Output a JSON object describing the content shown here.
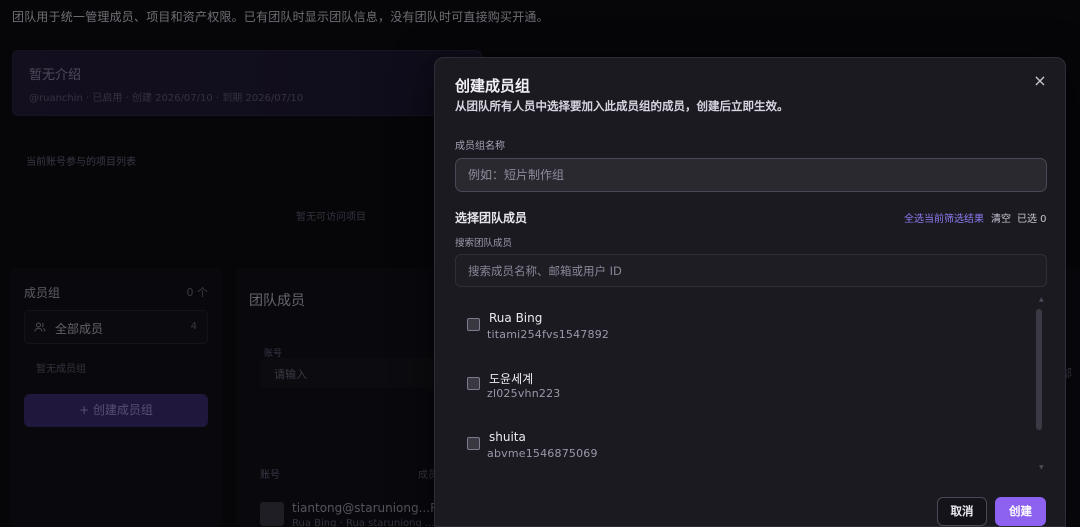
{
  "intro": "团队用于统一管理成员、项目和资产权限。已有团队时显示团队信息，没有团队时可直接购买开通。",
  "team_card": {
    "title": "暂无介绍",
    "meta": "@ruanchin  · 已启用 · 创建 2026/07/10 · 到期 2026/07/10"
  },
  "projects": {
    "label": "当前账号参与的项目列表",
    "empty": "暂无可访问项目"
  },
  "groups_panel": {
    "title": "成员组",
    "count": "0 个",
    "all_members_label": "全部成员",
    "all_members_count": "4",
    "empty": "暂无成员组",
    "create_label": "+  创建成员组"
  },
  "members_panel": {
    "title": "团队成员",
    "field_label": "账号",
    "field_placeholder": "请输入",
    "col_account": "账号",
    "col_b": "成员",
    "row_name": "tiantong@staruniong...Rua",
    "row_sub": "Rua Bing · Rua staruniong ...",
    "right_char": "部"
  },
  "modal": {
    "title": "创建成员组",
    "subtitle": "从团队所有人员中选择要加入此成员组的成员，创建后立即生效。",
    "close_icon": "×",
    "name_label": "成员组名称",
    "name_placeholder": "例如：短片制作组",
    "select_label": "选择团队成员",
    "select_all": "全选当前筛选结果",
    "clear": "清空",
    "selected": "已选 0",
    "search_label": "搜索团队成员",
    "search_placeholder": "搜索成员名称、邮箱或用户 ID",
    "members": [
      {
        "name": "Rua Bing",
        "id": "titami254fvs1547892"
      },
      {
        "name": "도윤세계",
        "id": "zl025vhn223"
      },
      {
        "name": "shuita",
        "id": "abvme1546875069"
      }
    ],
    "cancel_label": "取消",
    "create_label": "创建"
  },
  "colors": {
    "accent": "#8e62f1",
    "link": "#8b7cf1",
    "modal_bg": "#1b1a21"
  }
}
